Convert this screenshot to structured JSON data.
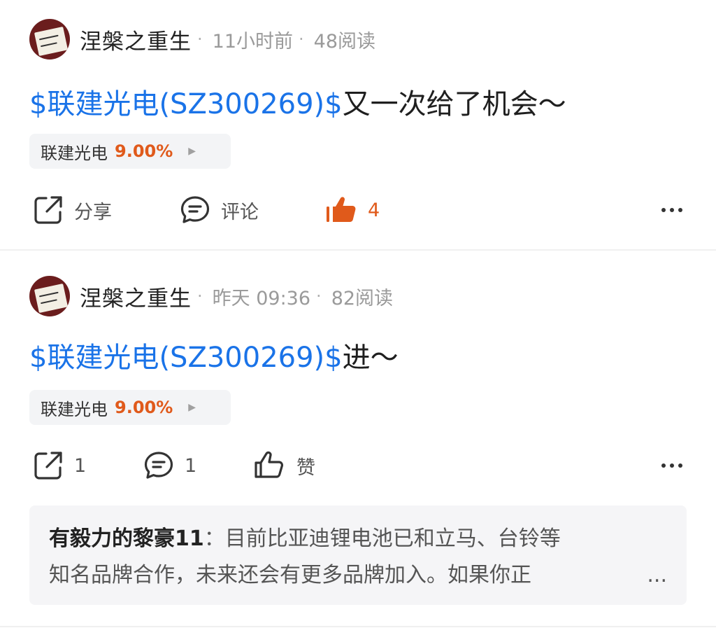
{
  "posts": [
    {
      "username": "涅槃之重生",
      "time": "11小时前",
      "reads": "48阅读",
      "stock_link": "$联建光电(SZ300269)$",
      "text": "又一次给了机会～",
      "ticker": {
        "name": "联建光电",
        "change": "9.00%"
      },
      "actions": {
        "share_label": "分享",
        "comment_label": "评论",
        "like_label": "4",
        "like_active": true
      }
    },
    {
      "username": "涅槃之重生",
      "time": "昨天 09:36",
      "reads": "82阅读",
      "stock_link": "$联建光电(SZ300269)$",
      "text": "进～",
      "ticker": {
        "name": "联建光电",
        "change": "9.00%"
      },
      "actions": {
        "share_label": "1",
        "comment_label": "1",
        "like_label": "赞",
        "like_active": false
      },
      "comment": {
        "author": "有毅力的黎豪11",
        "separator": "：",
        "line1": "目前比亚迪锂电池已和立马、台铃等",
        "line2": "知名品牌合作，未来还会有更多品牌加入。如果你正",
        "ellipsis": "..."
      }
    }
  ],
  "colors": {
    "link": "#1a73e8",
    "accent": "#e05a1b",
    "meta": "#9a9a9a"
  },
  "icons": [
    "share-icon",
    "comment-icon",
    "thumbs-up-icon",
    "more-icon",
    "arrow-right-icon"
  ]
}
